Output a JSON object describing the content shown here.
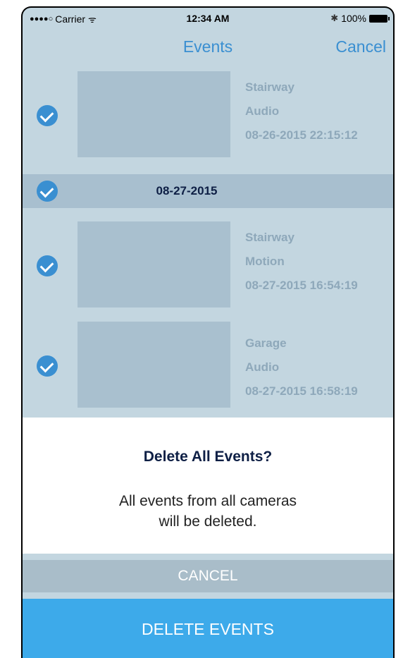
{
  "status_bar": {
    "signal": "●●●●○",
    "carrier": "Carrier",
    "time": "12:34 AM",
    "battery": "100%"
  },
  "nav": {
    "title": "Events",
    "cancel_label": "Cancel"
  },
  "events_top": [
    {
      "camera": "Stairway",
      "type": "Audio",
      "timestamp": "08-26-2015 22:15:12",
      "checked": true
    }
  ],
  "date_group": {
    "date": "08-27-2015",
    "checked": true
  },
  "events_group": [
    {
      "camera": "Stairway",
      "type": "Motion",
      "timestamp": "08-27-2015 16:54:19",
      "checked": true
    },
    {
      "camera": "Garage",
      "type": "Audio",
      "timestamp": "08-27-2015 16:58:19",
      "checked": true
    }
  ],
  "dialog": {
    "title": "Delete All Events?",
    "message_line1": "All events from all cameras",
    "message_line2": "will be deleted.",
    "cancel_label": "CANCEL",
    "delete_label": "DELETE EVENTS"
  },
  "colors": {
    "accent": "#3a8fd1",
    "delete_button": "#3daaea",
    "list_background": "#c3d6e0"
  }
}
